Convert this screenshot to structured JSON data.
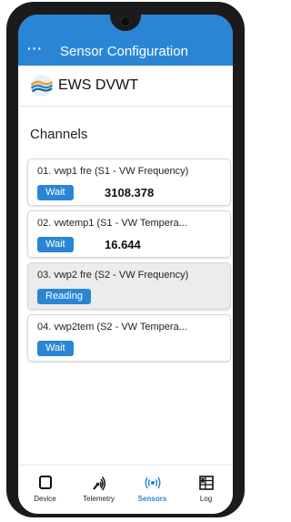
{
  "header": {
    "title": "Sensor Configuration",
    "menu_label": "···"
  },
  "brand": {
    "name": "EWS DVWT"
  },
  "section": {
    "title": "Channels"
  },
  "channels": [
    {
      "label": "01. vwp1 fre (S1 - VW Frequency)",
      "status": "Wait",
      "value": "3108.378"
    },
    {
      "label": "02. vwtemp1 (S1 - VW Tempera...",
      "status": "Wait",
      "value": "16.644"
    },
    {
      "label": "03. vwp2 fre (S2 - VW Frequency)",
      "status": "Reading",
      "value": ""
    },
    {
      "label": "04. vwp2tem (S2 - VW Tempera...",
      "status": "Wait",
      "value": ""
    }
  ],
  "tabs": [
    {
      "label": "Device",
      "icon": "device-icon"
    },
    {
      "label": "Telemetry",
      "icon": "telemetry-icon"
    },
    {
      "label": "Sensors",
      "icon": "sensors-icon",
      "active": true
    },
    {
      "label": "Log",
      "icon": "log-icon"
    }
  ],
  "colors": {
    "accent": "#2a86d4",
    "selected_card": "#ececec"
  }
}
